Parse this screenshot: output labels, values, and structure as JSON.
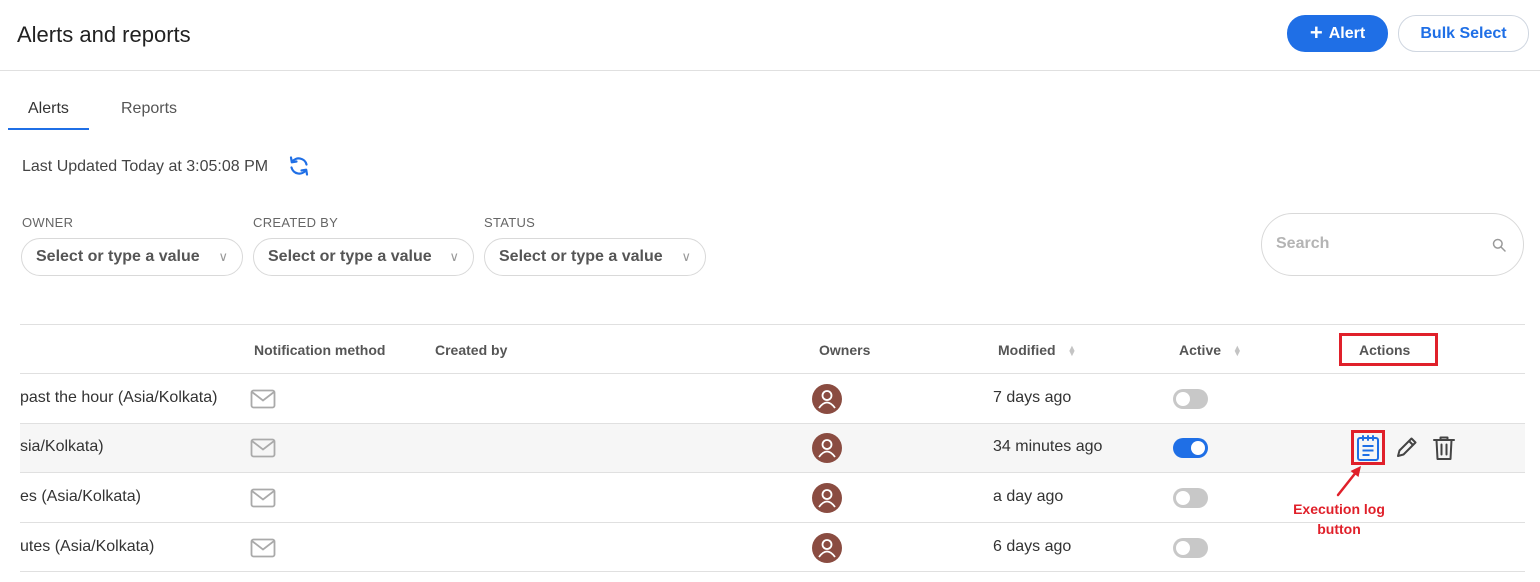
{
  "header": {
    "title": "Alerts and reports",
    "add_alert_plus": "+",
    "add_alert_label": "Alert",
    "bulk_select_label": "Bulk Select"
  },
  "tabs": [
    {
      "label": "Alerts",
      "active": true
    },
    {
      "label": "Reports",
      "active": false
    }
  ],
  "last_updated": "Last Updated Today at 3:05:08 PM",
  "filters": [
    {
      "label": "OWNER",
      "placeholder": "Select or type a value"
    },
    {
      "label": "CREATED BY",
      "placeholder": "Select or type a value"
    },
    {
      "label": "STATUS",
      "placeholder": "Select or type a value"
    }
  ],
  "search": {
    "placeholder": "Search"
  },
  "table": {
    "columns": {
      "notification_method": "Notification method",
      "created_by": "Created by",
      "owners": "Owners",
      "modified": "Modified",
      "active": "Active",
      "actions": "Actions"
    },
    "rows": [
      {
        "name": "past the hour (Asia/Kolkata)",
        "modified": "7 days ago",
        "active": false
      },
      {
        "name": "sia/Kolkata)",
        "modified": "34 minutes ago",
        "active": true
      },
      {
        "name": "es (Asia/Kolkata)",
        "modified": "a day ago",
        "active": false
      },
      {
        "name": "utes (Asia/Kolkata)",
        "modified": "6 days ago",
        "active": false
      }
    ]
  },
  "annotation": {
    "line1": "Execution log",
    "line2": "button"
  },
  "colors": {
    "accent": "#1f6fe6",
    "annotation": "#e0202a",
    "avatar": "#8a4c41"
  },
  "icons": [
    "refresh-icon",
    "search-icon",
    "mail-icon",
    "user-icon",
    "execution-log-icon",
    "edit-icon",
    "trash-icon",
    "sort-icon"
  ]
}
